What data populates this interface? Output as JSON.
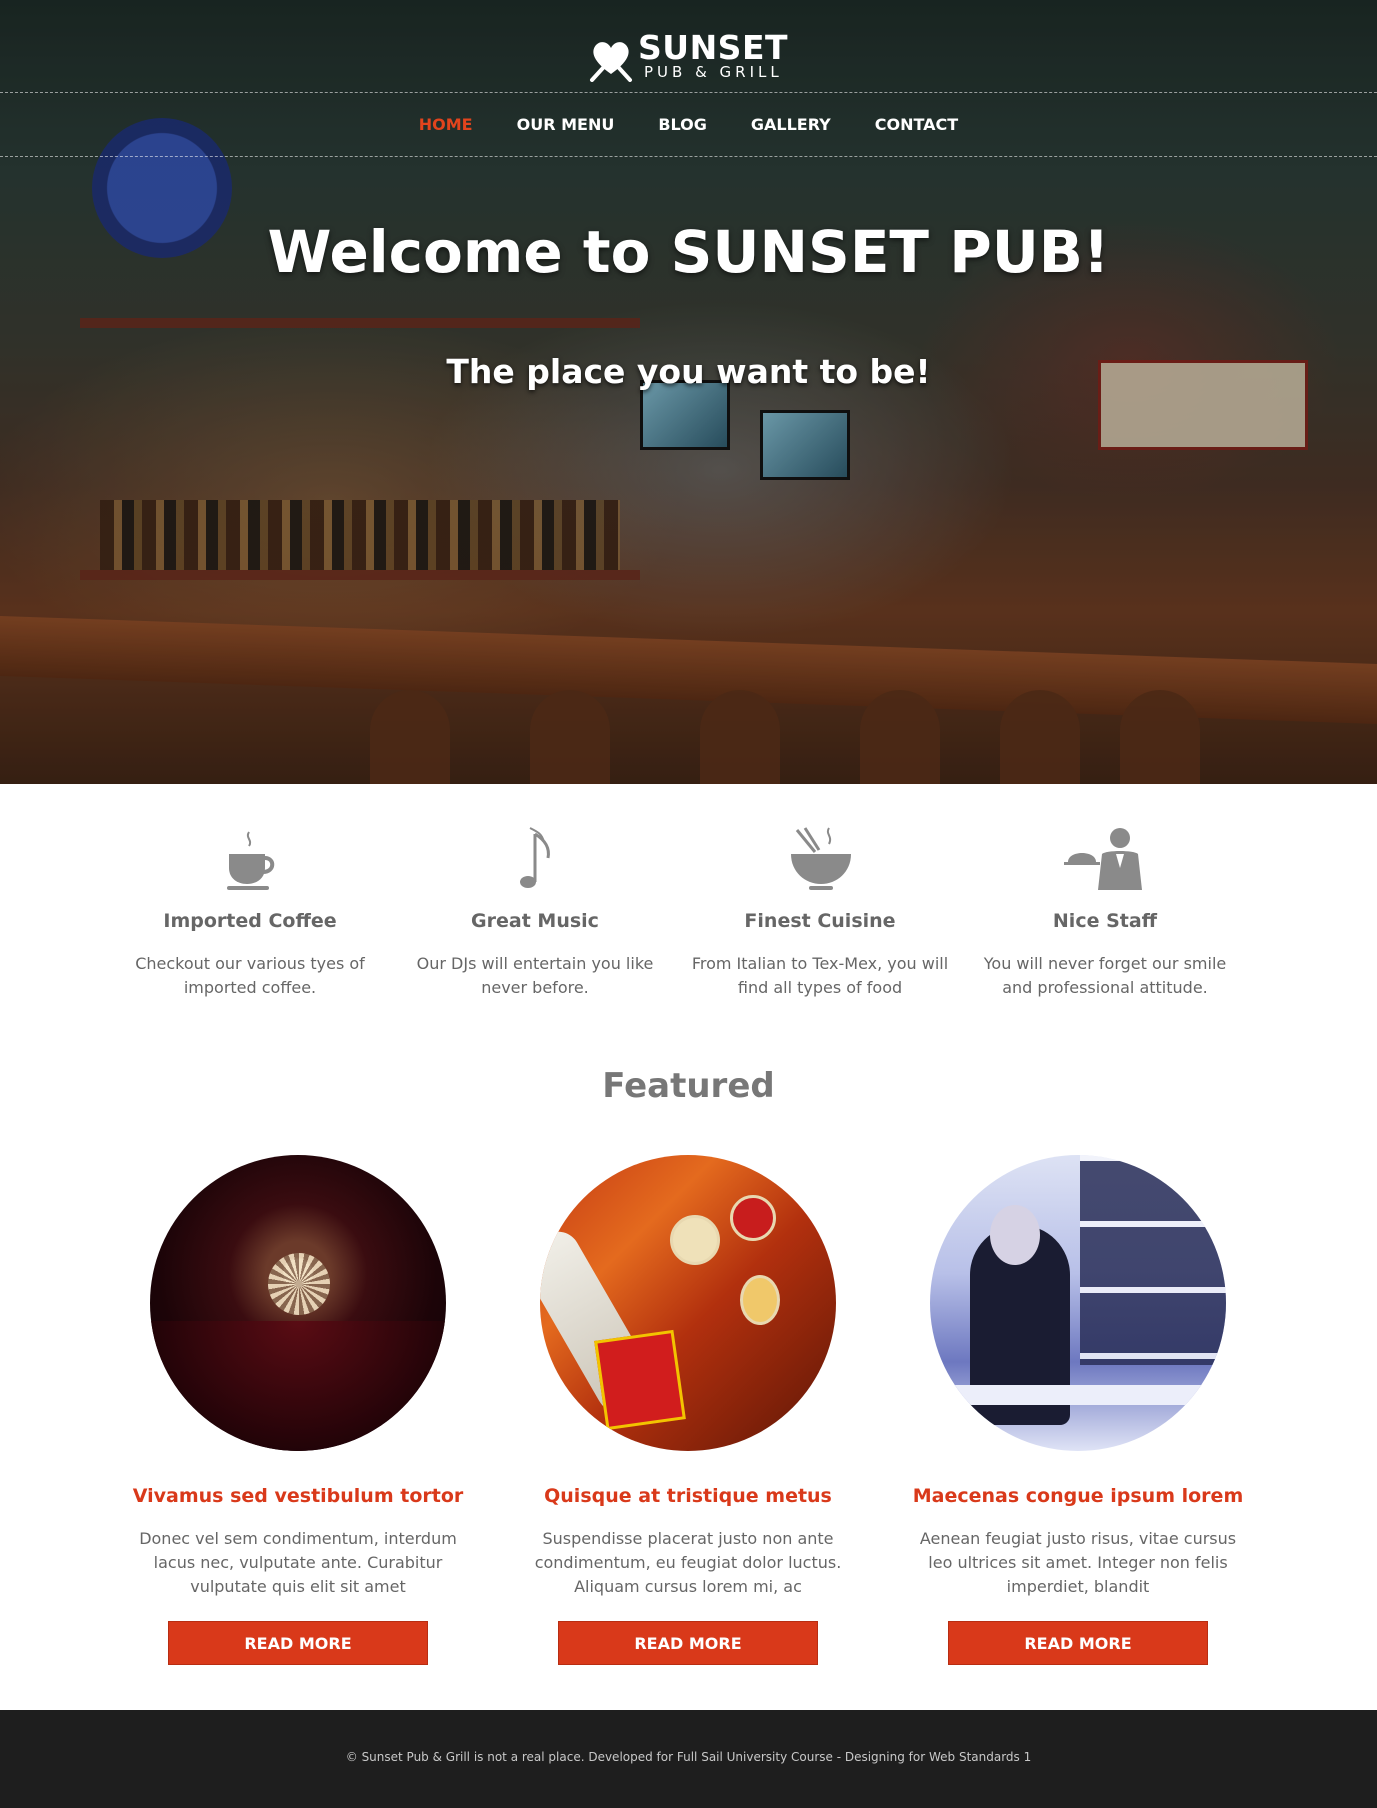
{
  "logo": {
    "title": "SUNSET",
    "subtitle": "PUB & GRILL"
  },
  "nav": {
    "items": [
      {
        "label": "HOME",
        "active": true
      },
      {
        "label": "OUR MENU",
        "active": false
      },
      {
        "label": "BLOG",
        "active": false
      },
      {
        "label": "GALLERY",
        "active": false
      },
      {
        "label": "CONTACT",
        "active": false
      }
    ]
  },
  "hero": {
    "title": "Welcome to SUNSET PUB!",
    "subtitle": "The place you want to be!"
  },
  "features": [
    {
      "icon": "coffee-cup-icon",
      "title": "Imported Coffee",
      "text": "Checkout our various tyes of imported coffee."
    },
    {
      "icon": "music-note-icon",
      "title": "Great Music",
      "text": "Our DJs will entertain you like never before."
    },
    {
      "icon": "food-bowl-icon",
      "title": "Finest Cuisine",
      "text": "From Italian to Tex-Mex, you will find all types of food"
    },
    {
      "icon": "waiter-icon",
      "title": "Nice Staff",
      "text": "You will never forget our smile and professional attitude."
    }
  ],
  "featured": {
    "heading": "Featured",
    "cards": [
      {
        "title": "Vivamus sed vestibulum tortor",
        "text": "Donec vel sem condimentum, interdum lacus nec, vulputate ante. Curabitur vulputate quis elit sit amet",
        "button": "READ MORE"
      },
      {
        "title": "Quisque at tristique metus",
        "text": "Suspendisse placerat justo non ante condimentum, eu feugiat dolor luctus. Aliquam cursus lorem mi, ac",
        "button": "READ MORE"
      },
      {
        "title": "Maecenas congue ipsum lorem",
        "text": "Aenean feugiat justo risus, vitae cursus leo ultrices sit amet. Integer non felis imperdiet, blandit",
        "button": "READ MORE"
      }
    ]
  },
  "footer": {
    "text": "© Sunset Pub & Grill is not a real place. Developed for Full Sail University Course - Designing for Web Standards 1"
  },
  "colors": {
    "accent": "#d9391a",
    "nav_active": "#e2441d",
    "footer_bg": "#1e1e1e",
    "icon_gray": "#8a8a8a"
  }
}
